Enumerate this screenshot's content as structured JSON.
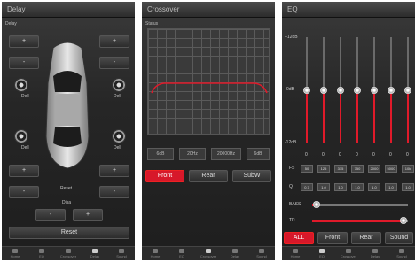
{
  "colors": {
    "accent": "#d7182a",
    "panel": "#262626"
  },
  "delay": {
    "title": "Delay",
    "sub": "Delay",
    "plus": "+",
    "minus": "-",
    "spk_fl": "Dell",
    "spk_fr": "Dell",
    "spk_rl": "Dell",
    "spk_rr": "Dell",
    "mid_label_1": "Reset",
    "mid_label_2": "Disa",
    "reset": "Reset"
  },
  "crossover": {
    "title": "Crossover",
    "sub": "Status",
    "boxes": [
      "6dB",
      "20Hz",
      "20000Hz",
      "6dB"
    ],
    "tabs": [
      "Front",
      "Rear",
      "SubW"
    ]
  },
  "eq": {
    "title": "EQ",
    "top_db": "+12dB",
    "mid_db": "0dB",
    "bot_db": "-12dB",
    "zeros": [
      "0",
      "0",
      "0",
      "0",
      "0",
      "0",
      "0"
    ],
    "fs_label": "FS",
    "q_label": "Q",
    "freqs": [
      "50",
      "125",
      "315",
      "750",
      "2000",
      "5000",
      "10k"
    ],
    "qs": [
      "0.7",
      "1.0",
      "1.0",
      "1.0",
      "1.0",
      "1.0",
      "1.0"
    ],
    "bass_label": "BASS",
    "treble_label": "TR",
    "bass_level": 0.05,
    "treble_level": 0.95,
    "tabs": [
      "ALL",
      "Front",
      "Rear",
      "Sound"
    ]
  },
  "nav": {
    "labels": [
      "Home",
      "EQ",
      "Crossover",
      "Delay",
      "Sound"
    ]
  }
}
